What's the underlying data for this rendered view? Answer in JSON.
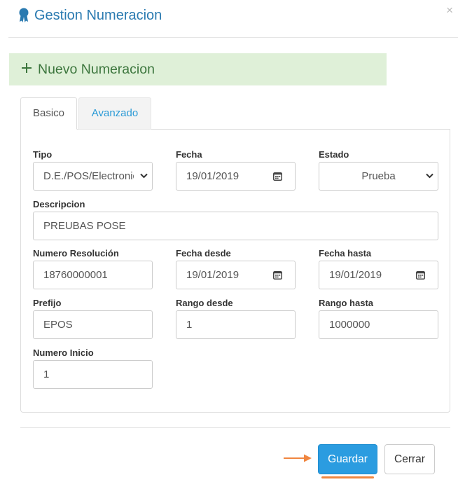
{
  "header": {
    "title": "Gestion Numeracion",
    "close_label": "×",
    "icon": "award-ribbon-icon"
  },
  "banner": {
    "label": "Nuevo Numeracion",
    "icon": "plus-icon"
  },
  "tabs": [
    {
      "label": "Basico",
      "active": true
    },
    {
      "label": "Avanzado",
      "active": false
    }
  ],
  "form": {
    "tipo": {
      "label": "Tipo",
      "value": "D.E./POS/Electronica"
    },
    "fecha": {
      "label": "Fecha",
      "value": "19/01/2019"
    },
    "estado": {
      "label": "Estado",
      "value": "Prueba"
    },
    "descripcion": {
      "label": "Descripcion",
      "value": "PREUBAS POSE"
    },
    "numero_resolucion": {
      "label": "Numero Resolución",
      "value": "18760000001"
    },
    "fecha_desde": {
      "label": "Fecha desde",
      "value": "19/01/2019"
    },
    "fecha_hasta": {
      "label": "Fecha hasta",
      "value": "19/01/2019"
    },
    "prefijo": {
      "label": "Prefijo",
      "value": "EPOS"
    },
    "rango_desde": {
      "label": "Rango desde",
      "value": "1"
    },
    "rango_hasta": {
      "label": "Rango hasta",
      "value": "1000000"
    },
    "numero_inicio": {
      "label": "Numero Inicio",
      "value": "1"
    }
  },
  "footer": {
    "save_label": "Guardar",
    "close_label": "Cerrar"
  },
  "colors": {
    "title": "#2a7ab0",
    "banner_bg": "#dff0d8",
    "banner_text": "#3c763d",
    "primary_button": "#2b9ce0",
    "annotation": "#f08640"
  }
}
